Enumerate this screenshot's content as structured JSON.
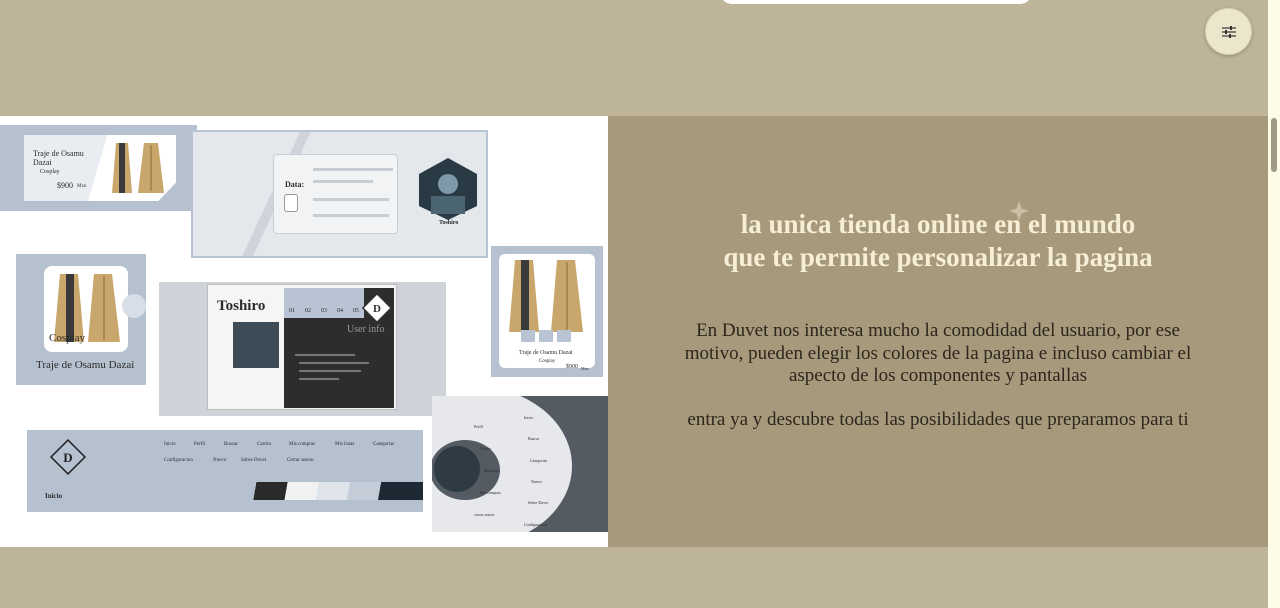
{
  "header": {
    "settings_icon": "sliders-icon"
  },
  "hero": {
    "headline_line1": "la unica tienda online en el mundo",
    "headline_line2": "que te permite personalizar la pagina",
    "paragraph1": "En Duvet nos interesa mucho la comodidad del usuario, por ese motivo, pueden elegir los colores de la pagina e incluso cambiar el aspecto de los componentes y pantallas",
    "paragraph2": "entra ya y descubre todas las posibilidades que preparamos para ti"
  },
  "collage": {
    "product_card_1": {
      "name": "Traje de Osamu Dazai",
      "category": "Cosplay",
      "price": "$900",
      "currency": "Mxn"
    },
    "data_panel": {
      "label": "Data:",
      "profile_name": "Toshiro"
    },
    "product_card_2": {
      "category": "Cosplay",
      "name": "Traje de Osamu Dazai"
    },
    "profile_panel": {
      "name": "Toshiro",
      "tabs": [
        "01",
        "02",
        "03",
        "04",
        "05"
      ],
      "user_info": "User info",
      "logo_letter": "D"
    },
    "product_card_3": {
      "name": "Traje de Osamu Dazai",
      "category": "Cosplay",
      "price": "$900",
      "currency": "Mxn"
    },
    "nav_panel": {
      "logo_letter": "D",
      "links": [
        "Inicio",
        "Perfil",
        "Buscar",
        "Carrito",
        "Mis compras",
        "Mis listas",
        "Categorias",
        "Configuracion",
        "Nuevo",
        "Sobre Duvet",
        "Cerrar sesion"
      ],
      "current": "Inicio"
    },
    "radial_menu": {
      "left_items": [
        "Perfil",
        "Carrito",
        "Mis listas",
        "Mis compras",
        "cerrar sesion"
      ],
      "right_items": [
        "Inicio",
        "Buscar",
        "Categorias",
        "Nuevo",
        "Sobre Duvet",
        "Configuracion"
      ]
    }
  },
  "colors": {
    "page_bg": "#bdb499",
    "promo_bg": "#a7997c",
    "headline": "#f6efd6",
    "body_text": "#2c261c",
    "accent_blue": "#b8c3d3"
  }
}
